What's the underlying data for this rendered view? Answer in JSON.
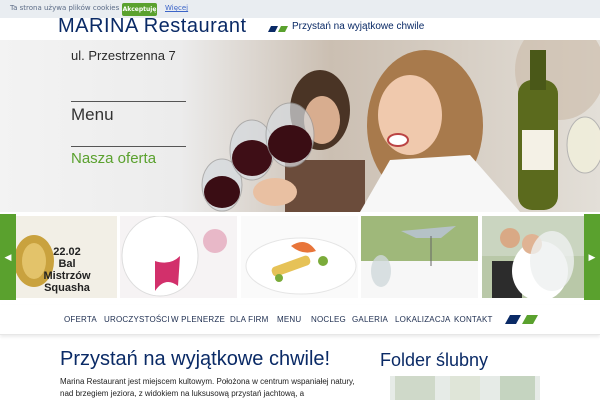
{
  "cookie_bar": {
    "message": "Ta strona używa plików cookies",
    "accept_label": "Akceptuję",
    "more_label": "Więcej"
  },
  "header": {
    "brand": "MARINA Restaurant",
    "tagline": "Przystań na wyjątkowe chwile"
  },
  "hero": {
    "address": "ul. Przestrzenna 7",
    "menu_link": "Menu",
    "offer_link": "Nasza oferta"
  },
  "carousel": {
    "prev_label": "◀",
    "next_label": "▶",
    "event_date": "22.02",
    "event_title": "Bal Mistrzów Squasha"
  },
  "nav": {
    "items": [
      "OFERTA",
      "UROCZYSTOŚCI",
      "W PLENERZE",
      "DLA FIRM",
      "MENU",
      "NOCLEG",
      "GALERIA",
      "LOKALIZACJA",
      "KONTAKT"
    ]
  },
  "content": {
    "title": "Przystań na wyjątkowe chwile!",
    "body": "Marina Restaurant jest miejscem kultowym. Położona w centrum wspaniałej natury, nad brzegiem jeziora, z widokiem na luksusową przystań jachtową, a"
  },
  "sidebar": {
    "title": "Folder ślubny"
  },
  "colors": {
    "brand_navy": "#0a2a66",
    "accent_green": "#5aa12e",
    "link_blue": "#3b64c8"
  }
}
